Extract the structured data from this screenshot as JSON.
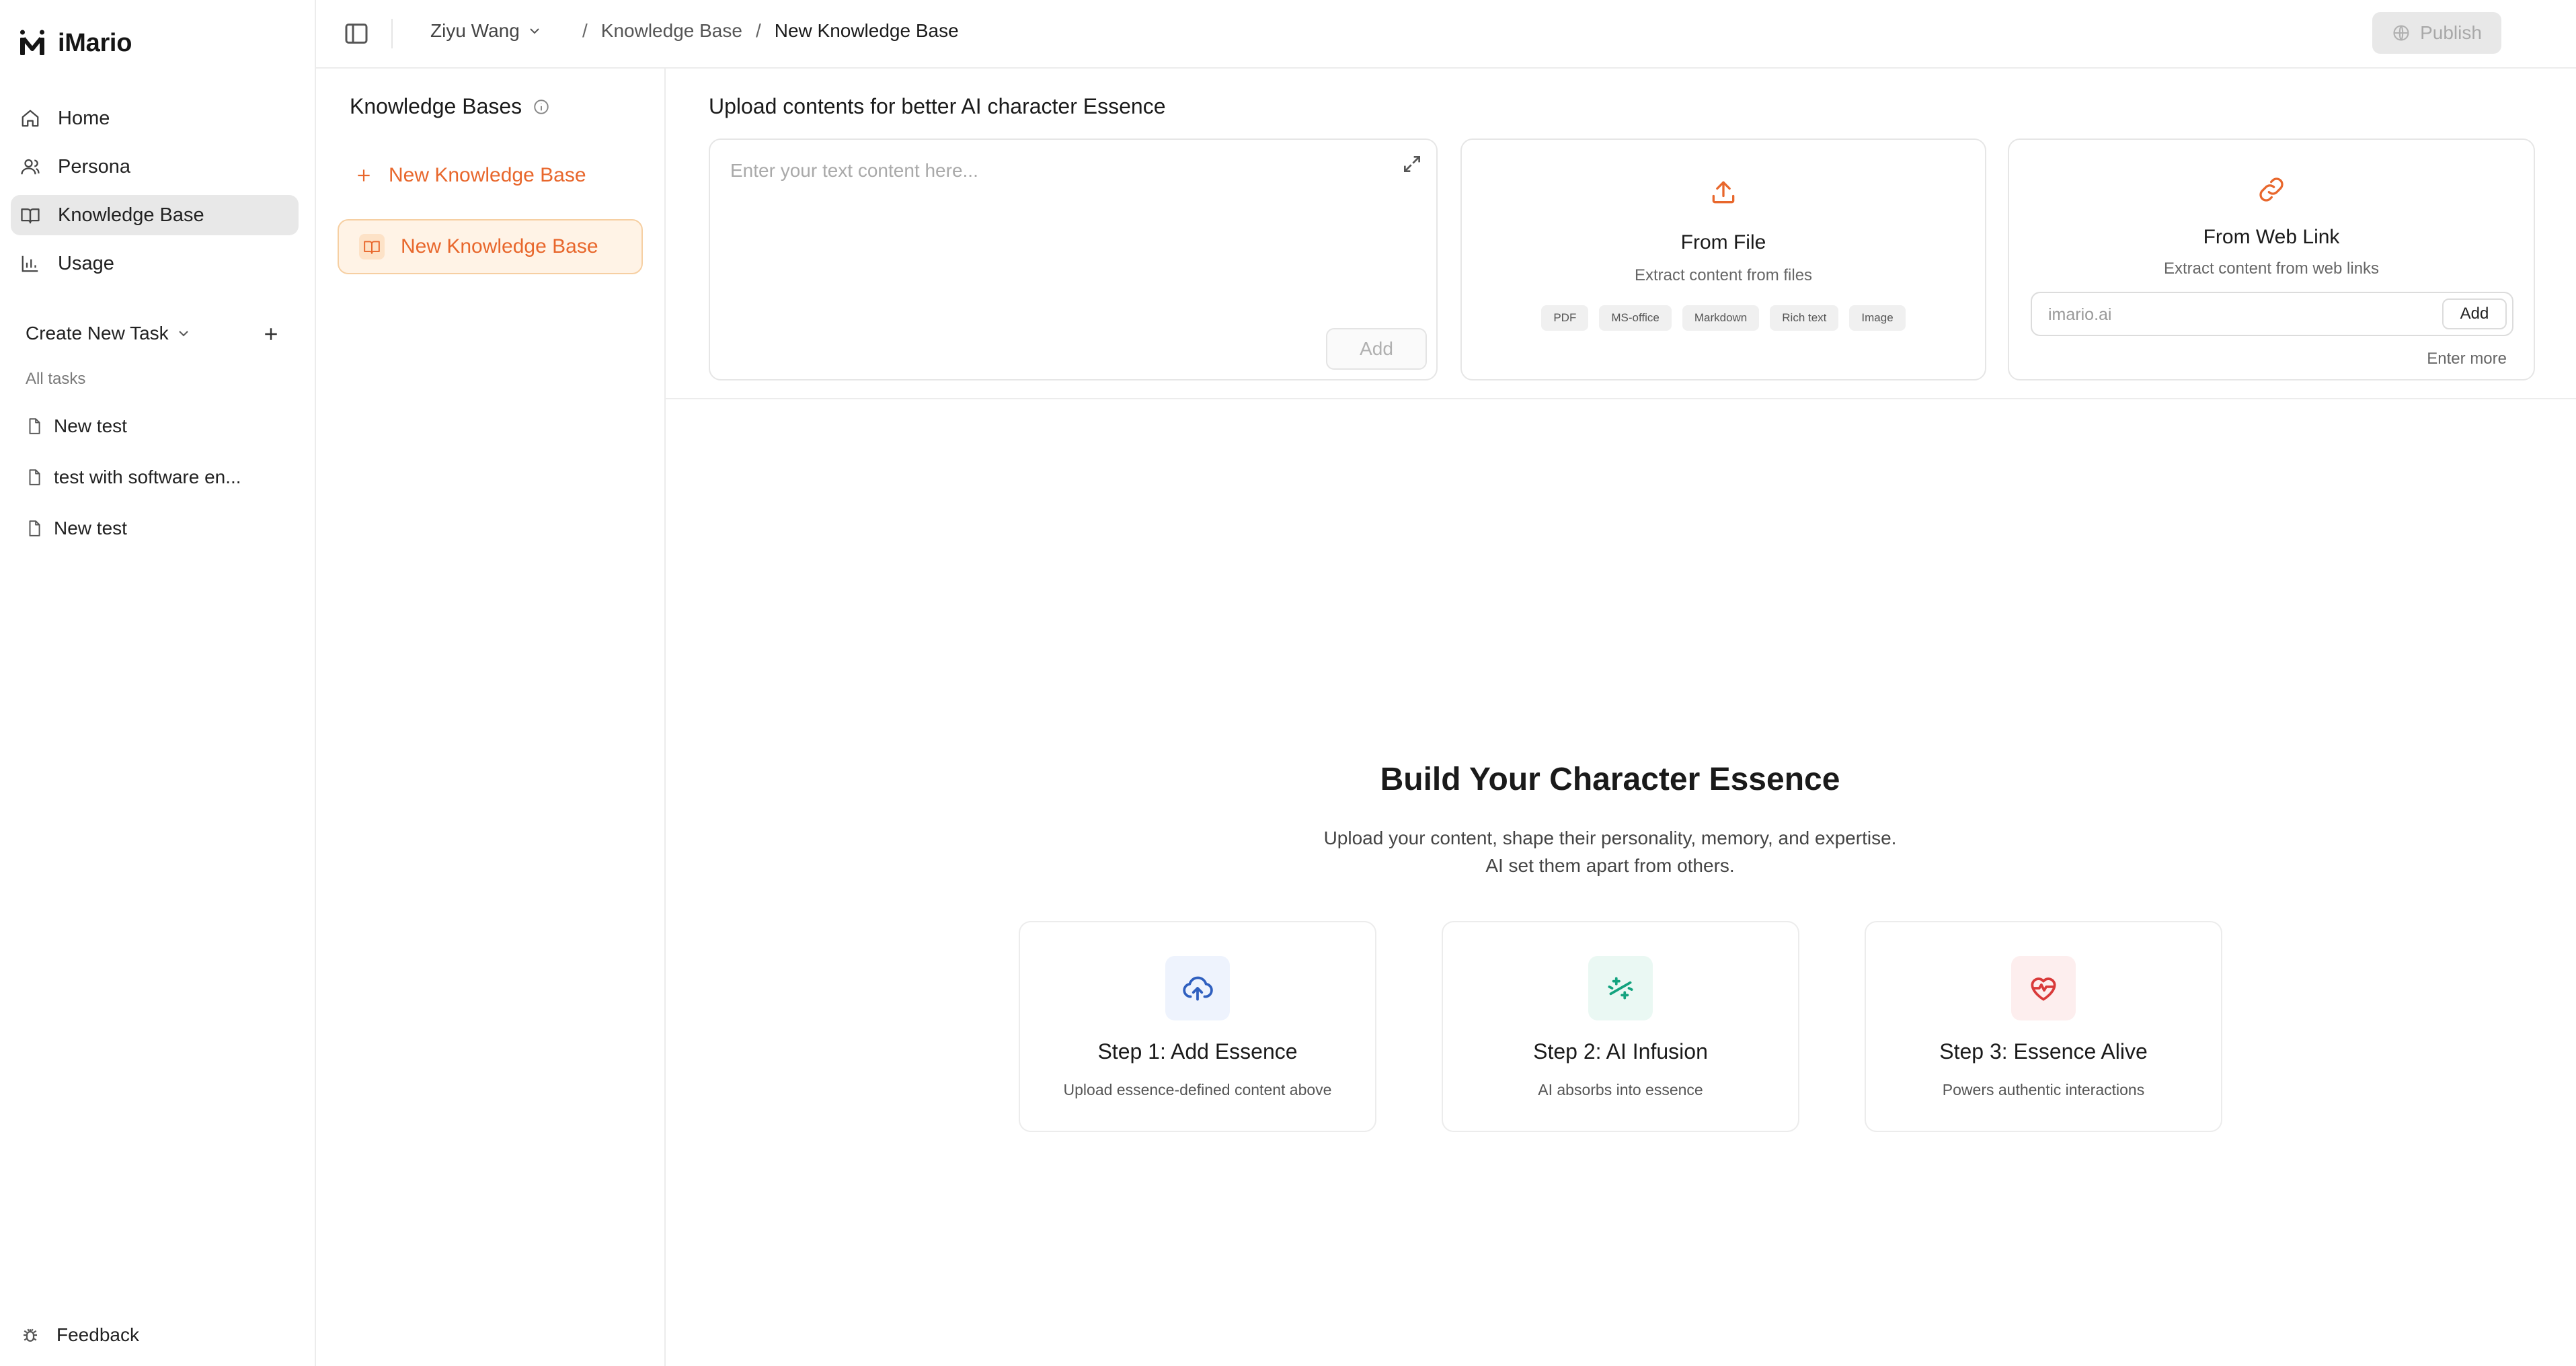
{
  "app": {
    "name": "iMario"
  },
  "sidebar": {
    "items": [
      {
        "label": "Home",
        "icon": "home-icon"
      },
      {
        "label": "Persona",
        "icon": "user-icon"
      },
      {
        "label": "Knowledge Base",
        "icon": "book-icon",
        "active": true
      },
      {
        "label": "Usage",
        "icon": "bar-chart-icon"
      }
    ],
    "create_task": "Create New Task",
    "tasks_label": "All tasks",
    "tasks": [
      {
        "label": "New test"
      },
      {
        "label": "test with software en..."
      },
      {
        "label": "New test"
      }
    ],
    "feedback": "Feedback"
  },
  "topbar": {
    "user": "Ziyu Wang",
    "breadcrumb": [
      "Knowledge Base",
      "New Knowledge Base"
    ],
    "publish": "Publish"
  },
  "kb_panel": {
    "title": "Knowledge Bases",
    "new_label": "New Knowledge Base",
    "items": [
      {
        "label": "New Knowledge Base"
      }
    ]
  },
  "upload": {
    "title": "Upload contents for better AI character Essence",
    "text": {
      "placeholder": "Enter your text content here...",
      "add": "Add"
    },
    "file": {
      "title": "From File",
      "subtitle": "Extract content from files",
      "types": [
        "PDF",
        "MS-office",
        "Markdown",
        "Rich text",
        "Image"
      ]
    },
    "web": {
      "title": "From Web Link",
      "subtitle": "Extract content from web links",
      "placeholder": "imario.ai",
      "add": "Add",
      "more": "Enter more"
    }
  },
  "hero": {
    "title": "Build Your Character Essence",
    "subtitle_line1": "Upload your content, shape their personality, memory, and expertise.",
    "subtitle_line2": "AI set them apart from others.",
    "steps": [
      {
        "title": "Step 1: Add Essence",
        "subtitle": "Upload essence-defined content above",
        "icon": "cloud-upload-icon",
        "color": "#2f5fbf",
        "bg": "#eef3fd"
      },
      {
        "title": "Step 2: AI Infusion",
        "subtitle": "AI absorbs into essence",
        "icon": "sparkle-icon",
        "color": "#14a37f",
        "bg": "#eaf8f3"
      },
      {
        "title": "Step 3: Essence Alive",
        "subtitle": "Powers authentic interactions",
        "icon": "heart-pulse-icon",
        "color": "#d93a3a",
        "bg": "#fdeeee"
      }
    ]
  },
  "colors": {
    "accent": "#e8672c",
    "accent_bg": "#fff3e6"
  }
}
